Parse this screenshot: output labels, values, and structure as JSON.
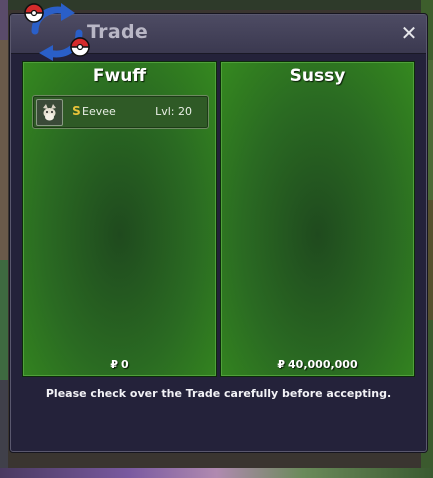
{
  "window": {
    "title": "Trade",
    "close_label": "✕",
    "notice": "Please check over the Trade carefully before accepting."
  },
  "left_panel": {
    "player": "Fwuff",
    "currency_symbol": "₽",
    "money": "0",
    "items": [
      {
        "shiny_marker": "S",
        "name": "Eevee",
        "level_label": "Lvl: 20",
        "icon": "eevee-sprite"
      }
    ]
  },
  "right_panel": {
    "player": "Sussy",
    "currency_symbol": "₽",
    "money": "40,000,000",
    "items": []
  },
  "colors": {
    "panel_green": "#2a6a22",
    "window_bg": "#24223a",
    "titlebar": "#45435a",
    "shiny_gold": "#e8c23a"
  }
}
